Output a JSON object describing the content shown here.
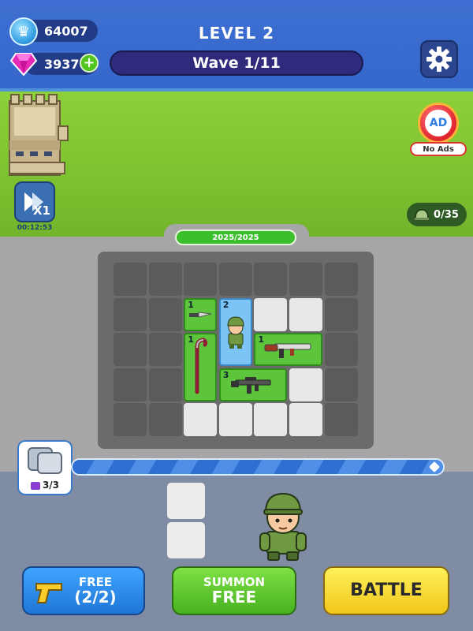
{
  "header": {
    "crowns": "64007",
    "gems": "3937",
    "plus": "+",
    "level": "LEVEL 2",
    "wave": "Wave 1/11"
  },
  "side": {
    "speed_label": "X1",
    "timer": "00:12:53",
    "ad_badge": "AD",
    "ad_label": "No Ads",
    "enemies": "0/35"
  },
  "board": {
    "hp_text": "2025/2025",
    "hp_fraction": 1.0,
    "pieces": [
      {
        "name": "knife",
        "level": "1"
      },
      {
        "name": "soldier",
        "level": "2"
      },
      {
        "name": "shotgun",
        "level": "1"
      },
      {
        "name": "crowbar",
        "level": "1"
      },
      {
        "name": "assault-rifle",
        "level": "3"
      }
    ]
  },
  "bench": {
    "count": "3/3"
  },
  "buttons": {
    "free_line1": "FREE",
    "free_line2": "(2/2)",
    "summon_line1": "SUMMON",
    "summon_line2": "FREE",
    "battle": "BATTLE"
  },
  "colors": {
    "sky": "#3567cc",
    "grass": "#7ec331",
    "green_piece": "#5cc53c",
    "blue_piece": "#7cc4f5",
    "battle_yellow": "#f0c71a"
  }
}
